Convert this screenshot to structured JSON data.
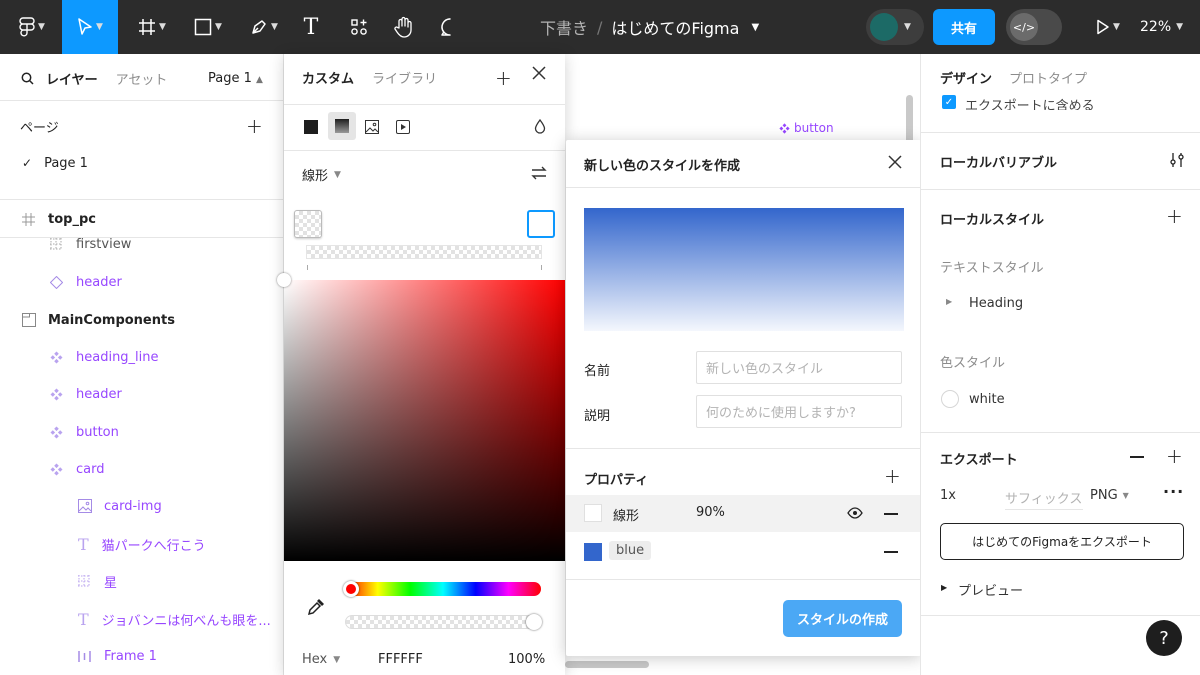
{
  "topbar": {
    "draft_label": "下書き",
    "separator": "/",
    "file_name": "はじめてのFigma",
    "share_label": "共有",
    "dev_mode_label": "</>",
    "zoom": "22%",
    "accent": "#0d99ff"
  },
  "left_panel": {
    "tab_layers": "レイヤー",
    "tab_assets": "アセット",
    "page_selector": "Page 1",
    "pages_heading": "ページ",
    "add_page": "+",
    "current_page": "Page 1",
    "layers": [
      {
        "name": "top_pc",
        "icon": "frame-icon"
      },
      {
        "name": "firstview",
        "icon": "grid-icon"
      },
      {
        "name": "header",
        "icon": "instance-icon"
      },
      {
        "name": "MainComponents",
        "icon": "section-icon"
      },
      {
        "name": "heading_line",
        "icon": "component-icon"
      },
      {
        "name": "header",
        "icon": "component-icon"
      },
      {
        "name": "button",
        "icon": "component-icon"
      },
      {
        "name": "card",
        "icon": "component-icon"
      },
      {
        "name": "card-img",
        "icon": "image-icon"
      },
      {
        "name": "猫パークへ行こう",
        "icon": "text-icon"
      },
      {
        "name": "星",
        "icon": "grid-icon"
      },
      {
        "name": "ジョバンニは何べんも眼を...",
        "icon": "text-icon"
      },
      {
        "name": "Frame 1",
        "icon": "columns-icon"
      }
    ]
  },
  "canvas": {
    "component_label": "button"
  },
  "picker": {
    "tab_custom": "カスタム",
    "tab_library": "ライブラリ",
    "gradient_type": "線形",
    "format": "Hex",
    "hex_value": "FFFFFF",
    "opacity": "100%",
    "hue_color": "#ff0000"
  },
  "dialog": {
    "title": "新しい色のスタイルを作成",
    "preview_top": "#3366cc",
    "preview_bottom": "#f4f7fd",
    "name_label": "名前",
    "name_placeholder": "新しい色のスタイル",
    "desc_label": "説明",
    "desc_placeholder": "何のために使用しますか?",
    "properties_heading": "プロパティ",
    "add_property": "+",
    "fill_rows": [
      {
        "label": "線形",
        "value": "90%"
      },
      {
        "label": "blue",
        "value": ""
      }
    ],
    "blue_swatch": "#3366cc",
    "create_label": "スタイルの作成",
    "create_color": "#4ba8f5"
  },
  "right_panel": {
    "tab_design": "デザイン",
    "tab_prototype": "プロトタイプ",
    "include_in_export": "エクスポートに含める",
    "local_variables": "ローカルバリアブル",
    "local_styles": "ローカルスタイル",
    "text_styles": "テキストスタイル",
    "text_style_item": "Heading",
    "color_styles": "色スタイル",
    "color_style_item": "white",
    "export_heading": "エクスポート",
    "export_scale": "1x",
    "export_suffix": "サフィックス",
    "export_format": "PNG",
    "export_button": "はじめてのFigmaをエクスポート",
    "preview": "プレビュー",
    "help": "?"
  }
}
